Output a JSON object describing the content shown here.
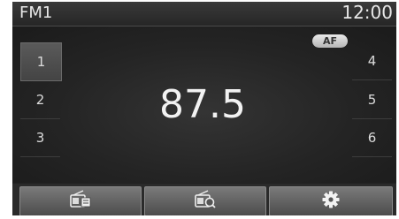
{
  "status_bar": {
    "band": "FM1",
    "time": "12:00"
  },
  "badges": {
    "af": "AF"
  },
  "radio": {
    "frequency": "87.5",
    "active_preset": "1"
  },
  "presets": {
    "left": [
      "1",
      "2",
      "3"
    ],
    "right": [
      "4",
      "5",
      "6"
    ]
  },
  "soft_keys": {
    "icons": [
      "radio-list-icon",
      "radio-scan-icon",
      "gear-icon"
    ]
  },
  "colors": {
    "screen_background": "#222222",
    "text": "#e8e8e8",
    "soft_key": "#6a6a6a"
  }
}
